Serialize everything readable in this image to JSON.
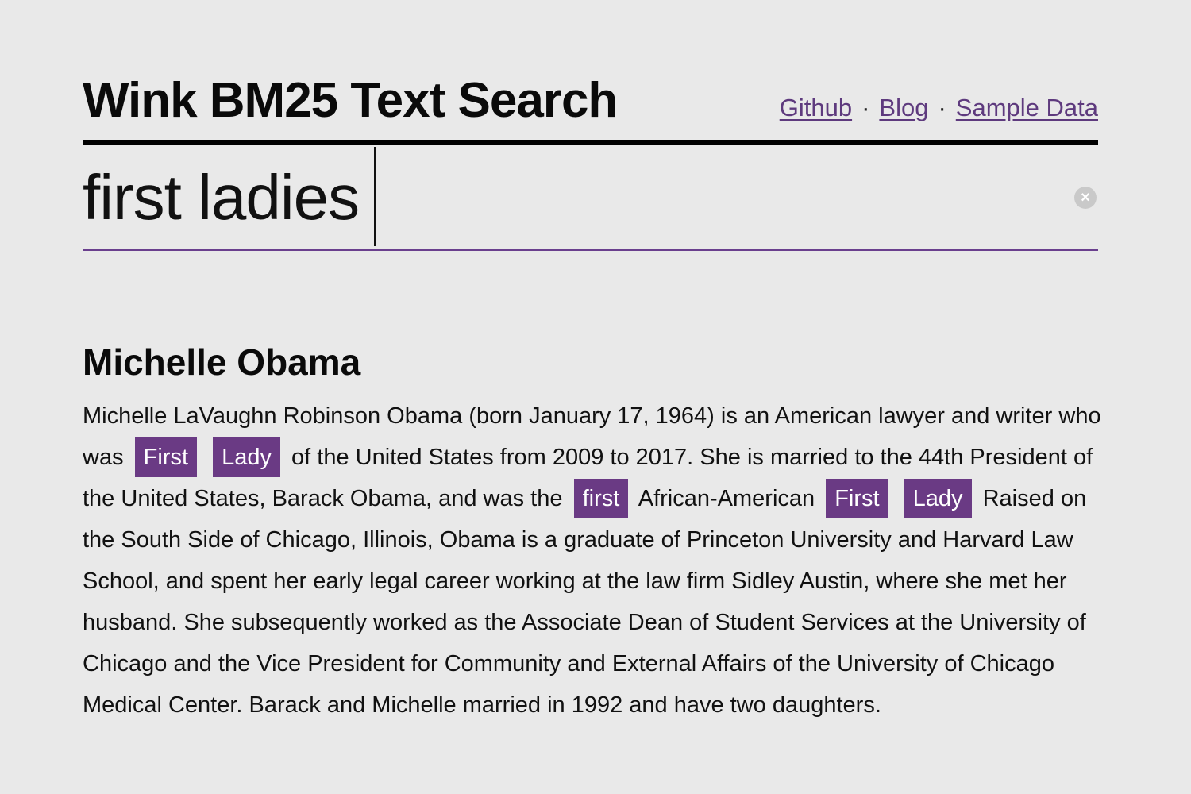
{
  "header": {
    "title": "Wink BM25 Text Search",
    "nav": [
      {
        "label": "Github"
      },
      {
        "label": "Blog"
      },
      {
        "label": "Sample Data"
      }
    ],
    "separator": "·"
  },
  "search": {
    "query": "first ladies",
    "clear_icon": "circle-x-icon"
  },
  "result": {
    "title": "Michelle Obama",
    "body": {
      "t1": "Michelle LaVaughn Robinson Obama (born January 17, 1964) is an American lawyer and writer who was",
      "h1": "First",
      "h2": "Lady",
      "t2": "of the United States from 2009 to 2017. She is married to the 44th President of the United States, Barack Obama, and was the",
      "h3": "first",
      "t3": "African-American",
      "h4": "First",
      "h5": "Lady",
      "t4": "Raised on the South Side of Chicago, Illinois, Obama is a graduate of Princeton University and Harvard Law School, and spent her early legal career working at the law firm Sidley Austin, where she met her husband. She subsequently worked as the Associate Dean of Student Services at the University of Chicago and the Vice President for Community and External Affairs of the University of Chicago Medical Center. Barack and Michelle married in 1992 and have two daughters."
    }
  },
  "colors": {
    "accent": "#6a3a84",
    "link": "#5e3a7e",
    "background": "#e9e9e9"
  }
}
